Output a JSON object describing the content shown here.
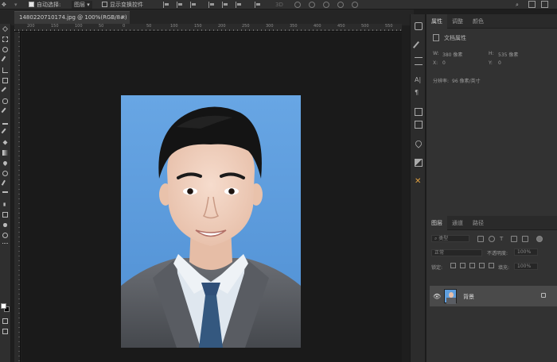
{
  "options_bar": {
    "auto_select_label": "自动选择:",
    "auto_select_value": "图层",
    "show_transform_label": "显示变换控件"
  },
  "document": {
    "tab_title": "1480220710174.jpg @ 100%(RGB/8#)",
    "close_glyph": "×"
  },
  "ruler": {
    "ticks": [
      "200",
      "150",
      "100",
      "50",
      "0",
      "50",
      "100",
      "150",
      "200",
      "250",
      "300",
      "350",
      "400",
      "450",
      "500",
      "550"
    ]
  },
  "properties_panel": {
    "tabs": [
      {
        "label": "属性",
        "active": true
      },
      {
        "label": "调整",
        "active": false
      },
      {
        "label": "颜色",
        "active": false
      }
    ],
    "section_title": "文档属性",
    "width_label": "W:",
    "width_value": "380 像素",
    "height_label": "H:",
    "height_value": "535 像素",
    "x_label": "X:",
    "x_value": "0",
    "y_label": "Y:",
    "y_value": "0",
    "resolution_label": "分辨率:",
    "resolution_value": "96 像素/英寸"
  },
  "layers_panel": {
    "tabs": [
      {
        "label": "图层",
        "active": true
      },
      {
        "label": "通道",
        "active": false
      },
      {
        "label": "路径",
        "active": false
      }
    ],
    "filter_kind": "类型",
    "blend_mode": "正常",
    "opacity_label": "不透明度:",
    "opacity_value": "100%",
    "lock_label": "锁定:",
    "fill_label": "填充:",
    "fill_value": "100%",
    "layers": [
      {
        "name": "背景",
        "visible": true,
        "locked": true
      }
    ]
  },
  "colors": {
    "photo_background": "#5f9fde",
    "foreground": "#ffffff",
    "background": "#000000",
    "panel_bg": "#323232",
    "canvas_bg": "#1a1a1a"
  }
}
